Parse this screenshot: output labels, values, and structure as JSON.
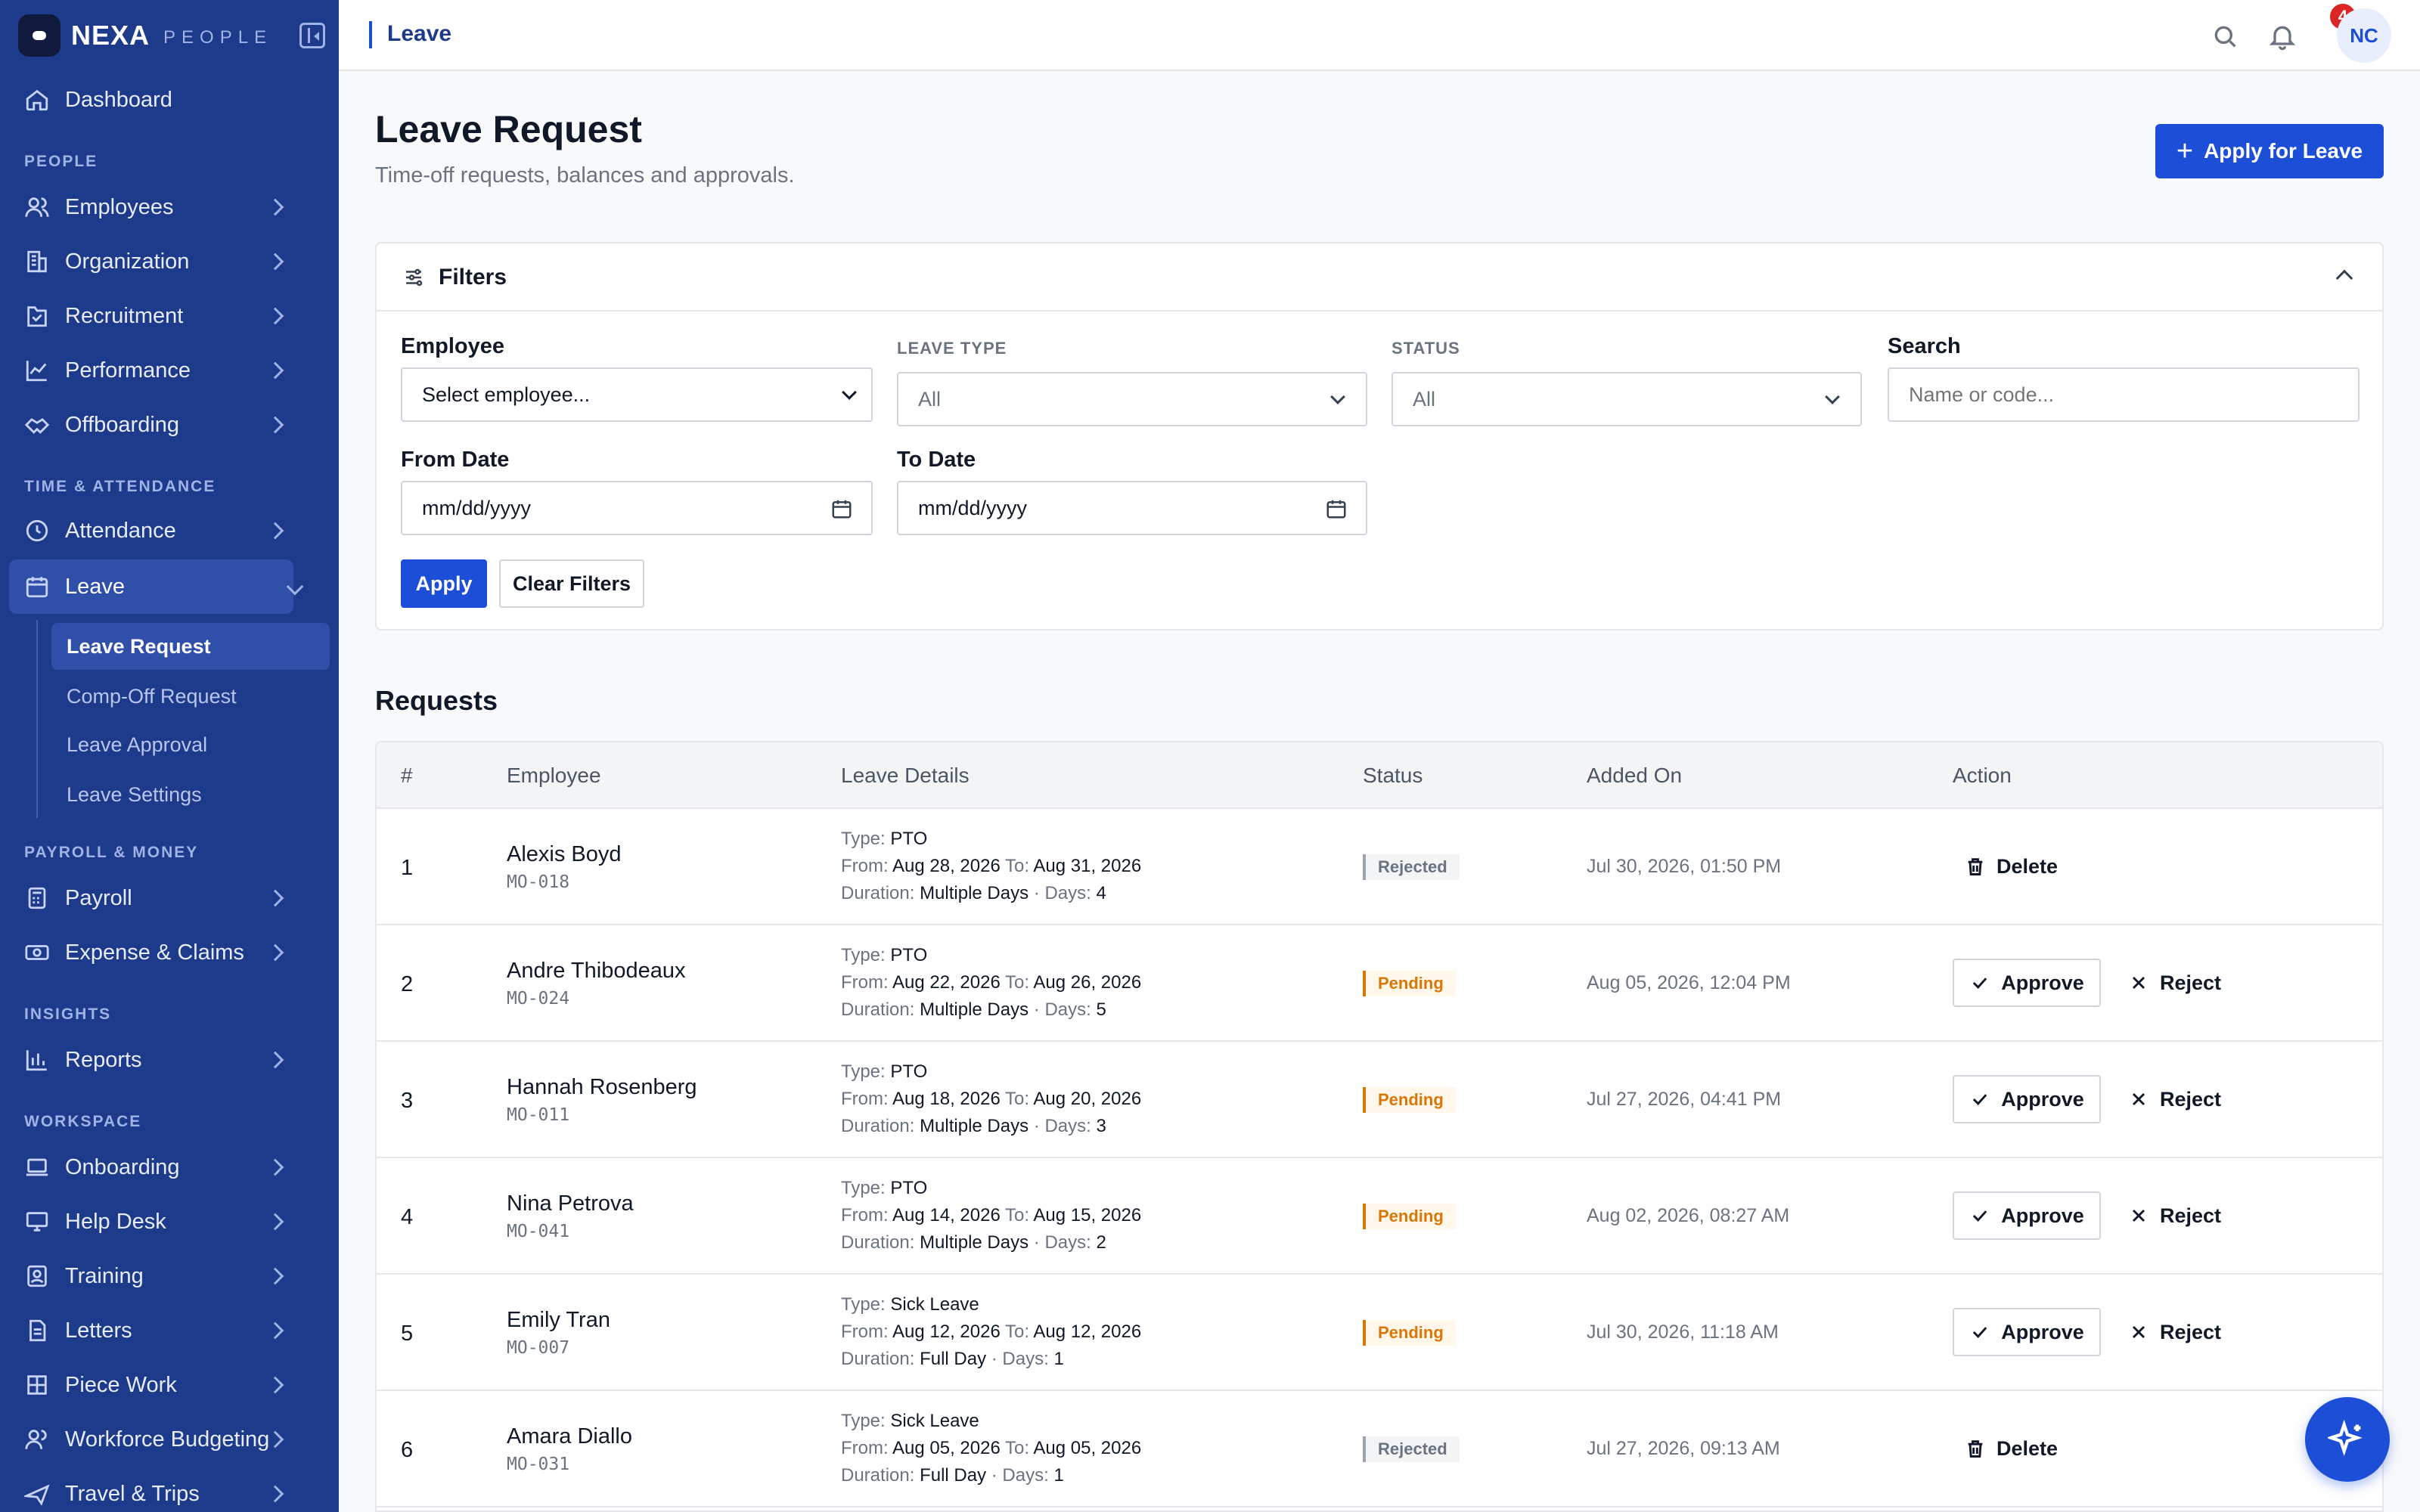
{
  "brand": {
    "name": "NEXA",
    "sub": "PEOPLE"
  },
  "sidebar": {
    "dashboard": "Dashboard",
    "sections": {
      "people": "PEOPLE",
      "time": "TIME & ATTENDANCE",
      "payroll": "PAYROLL & MONEY",
      "insights": "INSIGHTS",
      "workspace": "WORKSPACE"
    },
    "items": {
      "employees": "Employees",
      "organization": "Organization",
      "recruitment": "Recruitment",
      "performance": "Performance",
      "offboarding": "Offboarding",
      "attendance": "Attendance",
      "leave": "Leave",
      "payroll": "Payroll",
      "expense": "Expense & Claims",
      "reports": "Reports",
      "onboarding": "Onboarding",
      "helpdesk": "Help Desk",
      "training": "Training",
      "letters": "Letters",
      "piecework": "Piece Work",
      "budgeting": "Workforce Budgeting",
      "travel": "Travel & Trips"
    },
    "leave_sub": {
      "request": "Leave Request",
      "compoff": "Comp-Off Request",
      "approval": "Leave Approval",
      "settings": "Leave Settings"
    }
  },
  "topbar": {
    "breadcrumb": "Leave",
    "notif_count": "4",
    "avatar_initials": "NC"
  },
  "page": {
    "title": "Leave Request",
    "subtitle": "Time-off requests, balances and approvals.",
    "apply_button": "Apply for Leave"
  },
  "filters": {
    "title": "Filters",
    "employee_label": "Employee",
    "employee_value": "Select employee...",
    "leave_type_label": "LEAVE TYPE",
    "leave_type_value": "All",
    "status_label": "STATUS",
    "status_value": "All",
    "search_label": "Search",
    "search_placeholder": "Name or code...",
    "from_label": "From Date",
    "from_placeholder": "mm/dd/yyyy",
    "to_label": "To Date",
    "to_placeholder": "mm/dd/yyyy",
    "apply": "Apply",
    "clear": "Clear Filters"
  },
  "requests": {
    "title": "Requests",
    "columns": [
      "#",
      "Employee",
      "Leave Details",
      "Status",
      "Added On",
      "Action"
    ],
    "labels": {
      "type": "Type:",
      "from": "From:",
      "to": "To:",
      "duration": "Duration:",
      "days": "Days:",
      "approve": "Approve",
      "reject": "Reject",
      "delete": "Delete"
    },
    "rows": [
      {
        "num": "1",
        "name": "Alexis Boyd",
        "code": "MO-018",
        "type": "PTO",
        "from": "Aug 28, 2026",
        "to": "Aug 31, 2026",
        "duration": "Multiple Days",
        "days": "4",
        "status": "Rejected",
        "added": "Jul 30, 2026, 01:50 PM"
      },
      {
        "num": "2",
        "name": "Andre Thibodeaux",
        "code": "MO-024",
        "type": "PTO",
        "from": "Aug 22, 2026",
        "to": "Aug 26, 2026",
        "duration": "Multiple Days",
        "days": "5",
        "status": "Pending",
        "added": "Aug 05, 2026, 12:04 PM"
      },
      {
        "num": "3",
        "name": "Hannah Rosenberg",
        "code": "MO-011",
        "type": "PTO",
        "from": "Aug 18, 2026",
        "to": "Aug 20, 2026",
        "duration": "Multiple Days",
        "days": "3",
        "status": "Pending",
        "added": "Jul 27, 2026, 04:41 PM"
      },
      {
        "num": "4",
        "name": "Nina Petrova",
        "code": "MO-041",
        "type": "PTO",
        "from": "Aug 14, 2026",
        "to": "Aug 15, 2026",
        "duration": "Multiple Days",
        "days": "2",
        "status": "Pending",
        "added": "Aug 02, 2026, 08:27 AM"
      },
      {
        "num": "5",
        "name": "Emily Tran",
        "code": "MO-007",
        "type": "Sick Leave",
        "from": "Aug 12, 2026",
        "to": "Aug 12, 2026",
        "duration": "Full Day",
        "days": "1",
        "status": "Pending",
        "added": "Jul 30, 2026, 11:18 AM"
      },
      {
        "num": "6",
        "name": "Amara Diallo",
        "code": "MO-031",
        "type": "Sick Leave",
        "from": "Aug 05, 2026",
        "to": "Aug 05, 2026",
        "duration": "Full Day",
        "days": "1",
        "status": "Rejected",
        "added": "Jul 27, 2026, 09:13 AM"
      }
    ]
  },
  "colors": {
    "sidebar": "#1e3a8a",
    "primary": "#1d4ed8",
    "pending": "#d97706",
    "rejected": "#6b7280",
    "badge": "#dc2626"
  }
}
